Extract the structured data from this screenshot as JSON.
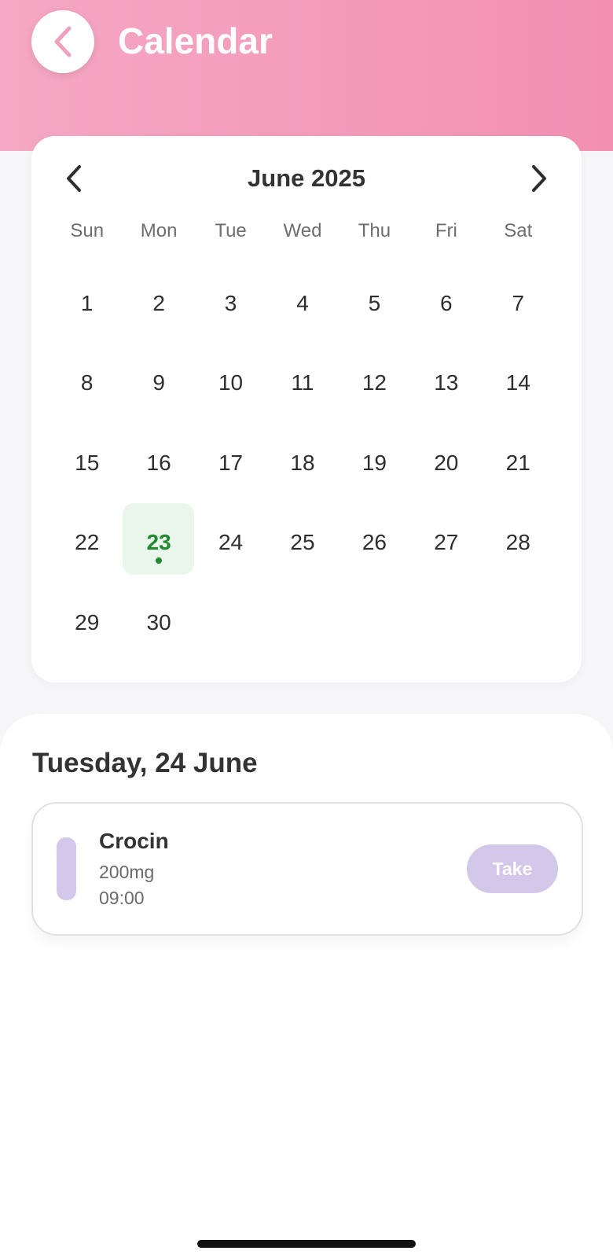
{
  "header": {
    "title": "Calendar",
    "back_icon": "chevron-left-icon",
    "gradient_start": "#f5a8c3",
    "gradient_end": "#f390b2"
  },
  "calendar": {
    "month_label": "June 2025",
    "prev_icon": "chevron-left-icon",
    "next_icon": "chevron-right-icon",
    "weekdays": [
      "Sun",
      "Mon",
      "Tue",
      "Wed",
      "Thu",
      "Fri",
      "Sat"
    ],
    "first_weekday_index": 0,
    "days": [
      "1",
      "2",
      "3",
      "4",
      "5",
      "6",
      "7",
      "8",
      "9",
      "10",
      "11",
      "12",
      "13",
      "14",
      "15",
      "16",
      "17",
      "18",
      "19",
      "20",
      "21",
      "22",
      "23",
      "24",
      "25",
      "26",
      "27",
      "28",
      "29",
      "30"
    ],
    "selected_day": "23",
    "selected_has_dot": true,
    "selected_color": "#1f8a2e",
    "selected_bg": "#eaf5ec"
  },
  "schedule": {
    "date_heading": "Tuesday, 24 June",
    "medications": [
      {
        "name": "Crocin",
        "dose": "200mg",
        "time": "09:00",
        "action_label": "Take",
        "color": "#d3c7ea"
      }
    ]
  }
}
